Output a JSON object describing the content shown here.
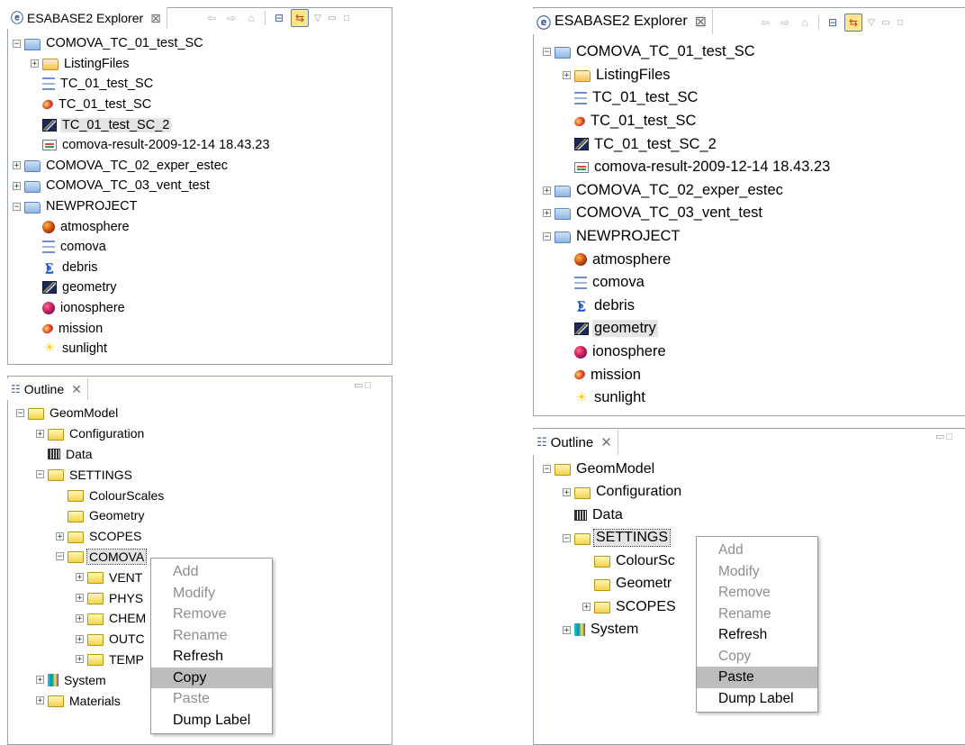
{
  "explorer": {
    "tab_title": "ESABASE2 Explorer",
    "tab_close": "⊠"
  },
  "outline": {
    "tab_title": "Outline",
    "tab_close": "✕"
  },
  "toolbar": {
    "back": "⇦",
    "forward": "⇨",
    "home": "⌂",
    "collapse": "⊟",
    "link": "⇆",
    "view_menu": "▽",
    "minimize": "▭",
    "maximize": "□"
  },
  "left": {
    "explorer_tree": [
      {
        "label": "COMOVA_TC_01_test_SC",
        "exp": "⊟",
        "icon": "folder-blue",
        "depth": 0
      },
      {
        "label": "ListingFiles",
        "exp": "⊞",
        "icon": "folder-orange",
        "depth": 1
      },
      {
        "label": "TC_01_test_SC",
        "exp": "",
        "icon": "comova-icon",
        "depth": 1
      },
      {
        "label": "TC_01_test_SC",
        "exp": "",
        "icon": "mission-icon",
        "depth": 1
      },
      {
        "label": "TC_01_test_SC_2",
        "exp": "",
        "icon": "geometry-icon",
        "depth": 1,
        "selected": true
      },
      {
        "label": "comova-result-2009-12-14 18.43.23",
        "exp": "",
        "icon": "result-icon",
        "depth": 1
      },
      {
        "label": "COMOVA_TC_02_exper_estec",
        "exp": "⊞",
        "icon": "folder-blue",
        "depth": 0
      },
      {
        "label": "COMOVA_TC_03_vent_test",
        "exp": "⊞",
        "icon": "folder-blue",
        "depth": 0
      },
      {
        "label": "NEWPROJECT",
        "exp": "⊟",
        "icon": "folder-blue",
        "depth": 0
      },
      {
        "label": "atmosphere",
        "exp": "",
        "icon": "atmosphere-icon",
        "depth": 1
      },
      {
        "label": "comova",
        "exp": "",
        "icon": "comova-icon",
        "depth": 1
      },
      {
        "label": "debris",
        "exp": "",
        "icon": "debris-icon",
        "depth": 1
      },
      {
        "label": "geometry",
        "exp": "",
        "icon": "geometry-icon",
        "depth": 1
      },
      {
        "label": "ionosphere",
        "exp": "",
        "icon": "ionosphere-icon",
        "depth": 1
      },
      {
        "label": "mission",
        "exp": "",
        "icon": "mission-icon",
        "depth": 1
      },
      {
        "label": "sunlight",
        "exp": "",
        "icon": "sunlight-icon",
        "depth": 1
      }
    ],
    "outline_tree": [
      {
        "label": "GeomModel",
        "exp": "⊟",
        "icon": "folder-yellow",
        "depth": 0
      },
      {
        "label": "Configuration",
        "exp": "⊞",
        "icon": "folder-yellow",
        "depth": 1
      },
      {
        "label": "Data",
        "exp": "",
        "icon": "data-icon",
        "depth": 1
      },
      {
        "label": "SETTINGS",
        "exp": "⊟",
        "icon": "folder-yellow",
        "depth": 1
      },
      {
        "label": "ColourScales",
        "exp": "",
        "icon": "folder-yellow",
        "depth": 2
      },
      {
        "label": "Geometry",
        "exp": "",
        "icon": "folder-yellow",
        "depth": 2
      },
      {
        "label": "SCOPES",
        "exp": "⊞",
        "icon": "folder-yellow",
        "depth": 2
      },
      {
        "label": "COMOVA",
        "exp": "⊟",
        "icon": "folder-yellow",
        "depth": 2,
        "focused": true
      },
      {
        "label": "VENT",
        "exp": "⊞",
        "icon": "folder-yellow",
        "depth": 3
      },
      {
        "label": "PHYS",
        "exp": "⊞",
        "icon": "folder-yellow",
        "depth": 3
      },
      {
        "label": "CHEM",
        "exp": "⊞",
        "icon": "folder-yellow",
        "depth": 3
      },
      {
        "label": "OUTC",
        "exp": "⊞",
        "icon": "folder-yellow",
        "depth": 3
      },
      {
        "label": "TEMP",
        "exp": "⊞",
        "icon": "folder-yellow",
        "depth": 3
      },
      {
        "label": "System",
        "exp": "⊞",
        "icon": "system-icon",
        "depth": 1
      },
      {
        "label": "Materials",
        "exp": "⊞",
        "icon": "folder-yellow",
        "depth": 1
      }
    ],
    "context_menu": [
      {
        "label": "Add",
        "enabled": false
      },
      {
        "label": "Modify",
        "enabled": false
      },
      {
        "label": "Remove",
        "enabled": false
      },
      {
        "label": "Rename",
        "enabled": false
      },
      {
        "label": "Refresh",
        "enabled": true
      },
      {
        "label": "Copy",
        "enabled": true,
        "hover": true
      },
      {
        "label": "Paste",
        "enabled": false
      },
      {
        "label": "Dump Label",
        "enabled": true
      }
    ]
  },
  "right": {
    "explorer_tree": [
      {
        "label": "COMOVA_TC_01_test_SC",
        "exp": "⊟",
        "icon": "folder-blue",
        "depth": 0
      },
      {
        "label": "ListingFiles",
        "exp": "⊞",
        "icon": "folder-orange",
        "depth": 1
      },
      {
        "label": "TC_01_test_SC",
        "exp": "",
        "icon": "comova-icon",
        "depth": 1
      },
      {
        "label": "TC_01_test_SC",
        "exp": "",
        "icon": "mission-icon",
        "depth": 1
      },
      {
        "label": "TC_01_test_SC_2",
        "exp": "",
        "icon": "geometry-icon",
        "depth": 1
      },
      {
        "label": "comova-result-2009-12-14 18.43.23",
        "exp": "",
        "icon": "result-icon",
        "depth": 1
      },
      {
        "label": "COMOVA_TC_02_exper_estec",
        "exp": "⊞",
        "icon": "folder-blue",
        "depth": 0
      },
      {
        "label": "COMOVA_TC_03_vent_test",
        "exp": "⊞",
        "icon": "folder-blue",
        "depth": 0
      },
      {
        "label": "NEWPROJECT",
        "exp": "⊟",
        "icon": "folder-blue",
        "depth": 0
      },
      {
        "label": "atmosphere",
        "exp": "",
        "icon": "atmosphere-icon",
        "depth": 1
      },
      {
        "label": "comova",
        "exp": "",
        "icon": "comova-icon",
        "depth": 1
      },
      {
        "label": "debris",
        "exp": "",
        "icon": "debris-icon",
        "depth": 1
      },
      {
        "label": "geometry",
        "exp": "",
        "icon": "geometry-icon",
        "depth": 1,
        "selected": true
      },
      {
        "label": "ionosphere",
        "exp": "",
        "icon": "ionosphere-icon",
        "depth": 1
      },
      {
        "label": "mission",
        "exp": "",
        "icon": "mission-icon",
        "depth": 1
      },
      {
        "label": "sunlight",
        "exp": "",
        "icon": "sunlight-icon",
        "depth": 1
      }
    ],
    "outline_tree": [
      {
        "label": "GeomModel",
        "exp": "⊟",
        "icon": "folder-yellow",
        "depth": 0
      },
      {
        "label": "Configuration",
        "exp": "⊞",
        "icon": "folder-yellow",
        "depth": 1
      },
      {
        "label": "Data",
        "exp": "",
        "icon": "data-icon",
        "depth": 1
      },
      {
        "label": "SETTINGS",
        "exp": "⊟",
        "icon": "folder-yellow",
        "depth": 1,
        "focused": true
      },
      {
        "label": "ColourSc",
        "exp": "",
        "icon": "folder-yellow",
        "depth": 2
      },
      {
        "label": "Geometr",
        "exp": "",
        "icon": "folder-yellow",
        "depth": 2
      },
      {
        "label": "SCOPES",
        "exp": "⊞",
        "icon": "folder-yellow",
        "depth": 2
      },
      {
        "label": "System",
        "exp": "⊞",
        "icon": "system-icon",
        "depth": 1
      }
    ],
    "context_menu": [
      {
        "label": "Add",
        "enabled": false
      },
      {
        "label": "Modify",
        "enabled": false
      },
      {
        "label": "Remove",
        "enabled": false
      },
      {
        "label": "Rename",
        "enabled": false
      },
      {
        "label": "Refresh",
        "enabled": true
      },
      {
        "label": "Copy",
        "enabled": false
      },
      {
        "label": "Paste",
        "enabled": true,
        "hover": true
      },
      {
        "label": "Dump Label",
        "enabled": true
      }
    ]
  }
}
